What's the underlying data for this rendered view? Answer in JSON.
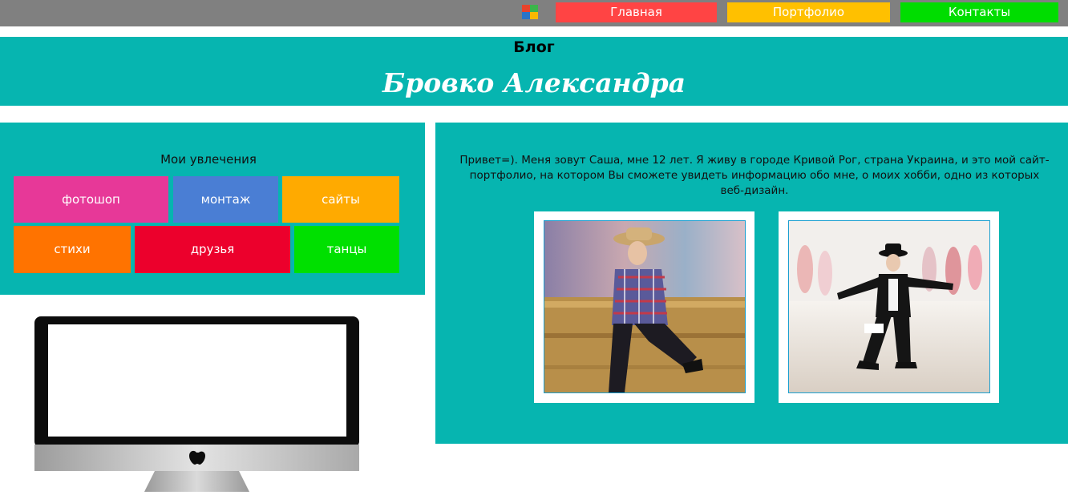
{
  "topbar": {
    "background": "#808080",
    "nav": [
      {
        "label": "Главная",
        "color": "#ff4444"
      },
      {
        "label": "Портфолио",
        "color": "#ffc000"
      },
      {
        "label": "Контакты",
        "color": "#00dd00"
      }
    ]
  },
  "header": {
    "blog_label": "Блог",
    "title": "Бровко Александра",
    "background": "#06b5b0"
  },
  "hobbies": {
    "title": "Мои увлечения",
    "items": [
      {
        "label": "фотошоп",
        "color": "#e73898"
      },
      {
        "label": "монтаж",
        "color": "#4a7ed4"
      },
      {
        "label": "сайты",
        "color": "#ffaa00"
      },
      {
        "label": "стихи",
        "color": "#ff7300"
      },
      {
        "label": "друзья",
        "color": "#ec002c"
      },
      {
        "label": "танцы",
        "color": "#00e000"
      }
    ]
  },
  "main": {
    "intro": "Привет=). Меня зовут Саша, мне 12 лет. Я живу в городе Кривой Рог, страна Украина, и это мой сайт-портфолио, на котором Вы сможете увидеть информацию обо мне, о моих хобби, одно из которых веб-дизайн."
  }
}
